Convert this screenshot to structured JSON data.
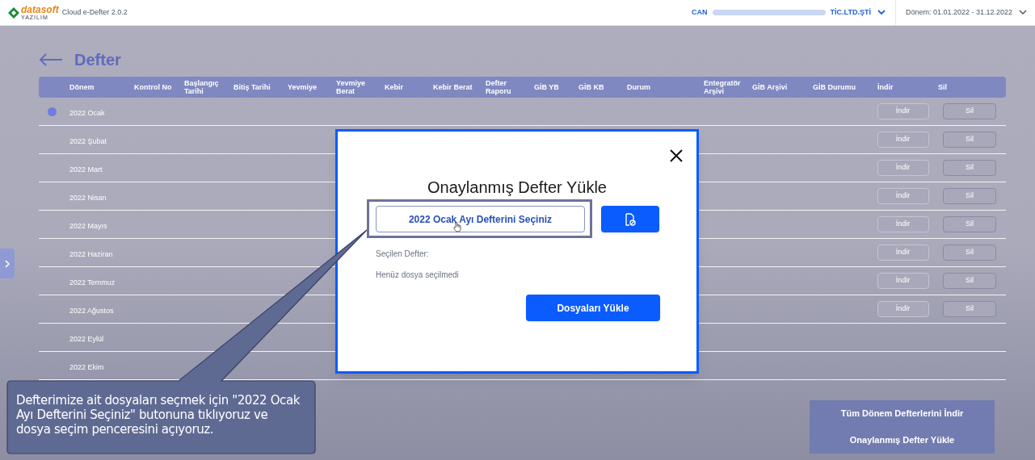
{
  "header": {
    "brand": "datasoft",
    "brand_subtitle": "YAZILIM",
    "product": "Cloud e-Defter 2.0.2",
    "company_prefix": "CAN",
    "company_suffix": "TİC.LTD.ŞTİ",
    "period": "Dönem: 01.01.2022 - 31.12.2022"
  },
  "page": {
    "title": "Defter"
  },
  "table": {
    "columns": [
      "Dönem",
      "Kontrol No",
      "Başlangıç Tarihi",
      "Bitiş Tarihi",
      "Yevmiye",
      "Yevmiye Berat",
      "Kebir",
      "Kebir Berat",
      "Defter Raporu",
      "GİB YB",
      "GİB KB",
      "Durum",
      "Entegratör Arşivi",
      "GİB Arşivi",
      "GİB Durumu",
      "İndir",
      "Sil"
    ],
    "rows": [
      {
        "period": "2022 Ocak",
        "selected": true,
        "download": "İndir",
        "delete": "Sil"
      },
      {
        "period": "2022 Şubat",
        "selected": false,
        "download": "İndir",
        "delete": "Sil"
      },
      {
        "period": "2022 Mart",
        "selected": false,
        "download": "İndir",
        "delete": "Sil"
      },
      {
        "period": "2022 Nisan",
        "selected": false,
        "download": "İndir",
        "delete": "Sil"
      },
      {
        "period": "2022 Mayıs",
        "selected": false,
        "download": "İndir",
        "delete": "Sil"
      },
      {
        "period": "2022 Haziran",
        "selected": false,
        "download": "İndir",
        "delete": "Sil"
      },
      {
        "period": "2022 Temmuz",
        "selected": false,
        "download": "İndir",
        "delete": "Sil"
      },
      {
        "period": "2022 Ağustos",
        "selected": false,
        "download": "İndir",
        "delete": "Sil"
      },
      {
        "period": "2022 Eylül",
        "selected": false
      },
      {
        "period": "2022 Ekim",
        "selected": false
      }
    ]
  },
  "side_panel": {
    "buttons": [
      "Tüm Dönem Defterlerini İndir",
      "Onaylanmış Defter Yükle"
    ]
  },
  "modal": {
    "title": "Onaylanmış Defter Yükle",
    "select_button": "2022 Ocak Ayı Defterini Seçiniz",
    "selected_label": "Seçilen Defter:",
    "selected_value": "Henüz dosya seçilmedi",
    "upload_button": "Dosyaları Yükle"
  },
  "callout": {
    "text": "Defterimize ait dosyaları seçmek için \"2022 Ocak Ayı Defterini Seçiniz\" butonuna tıklıyoruz ve dosya seçim penceresini açıyoruz."
  }
}
